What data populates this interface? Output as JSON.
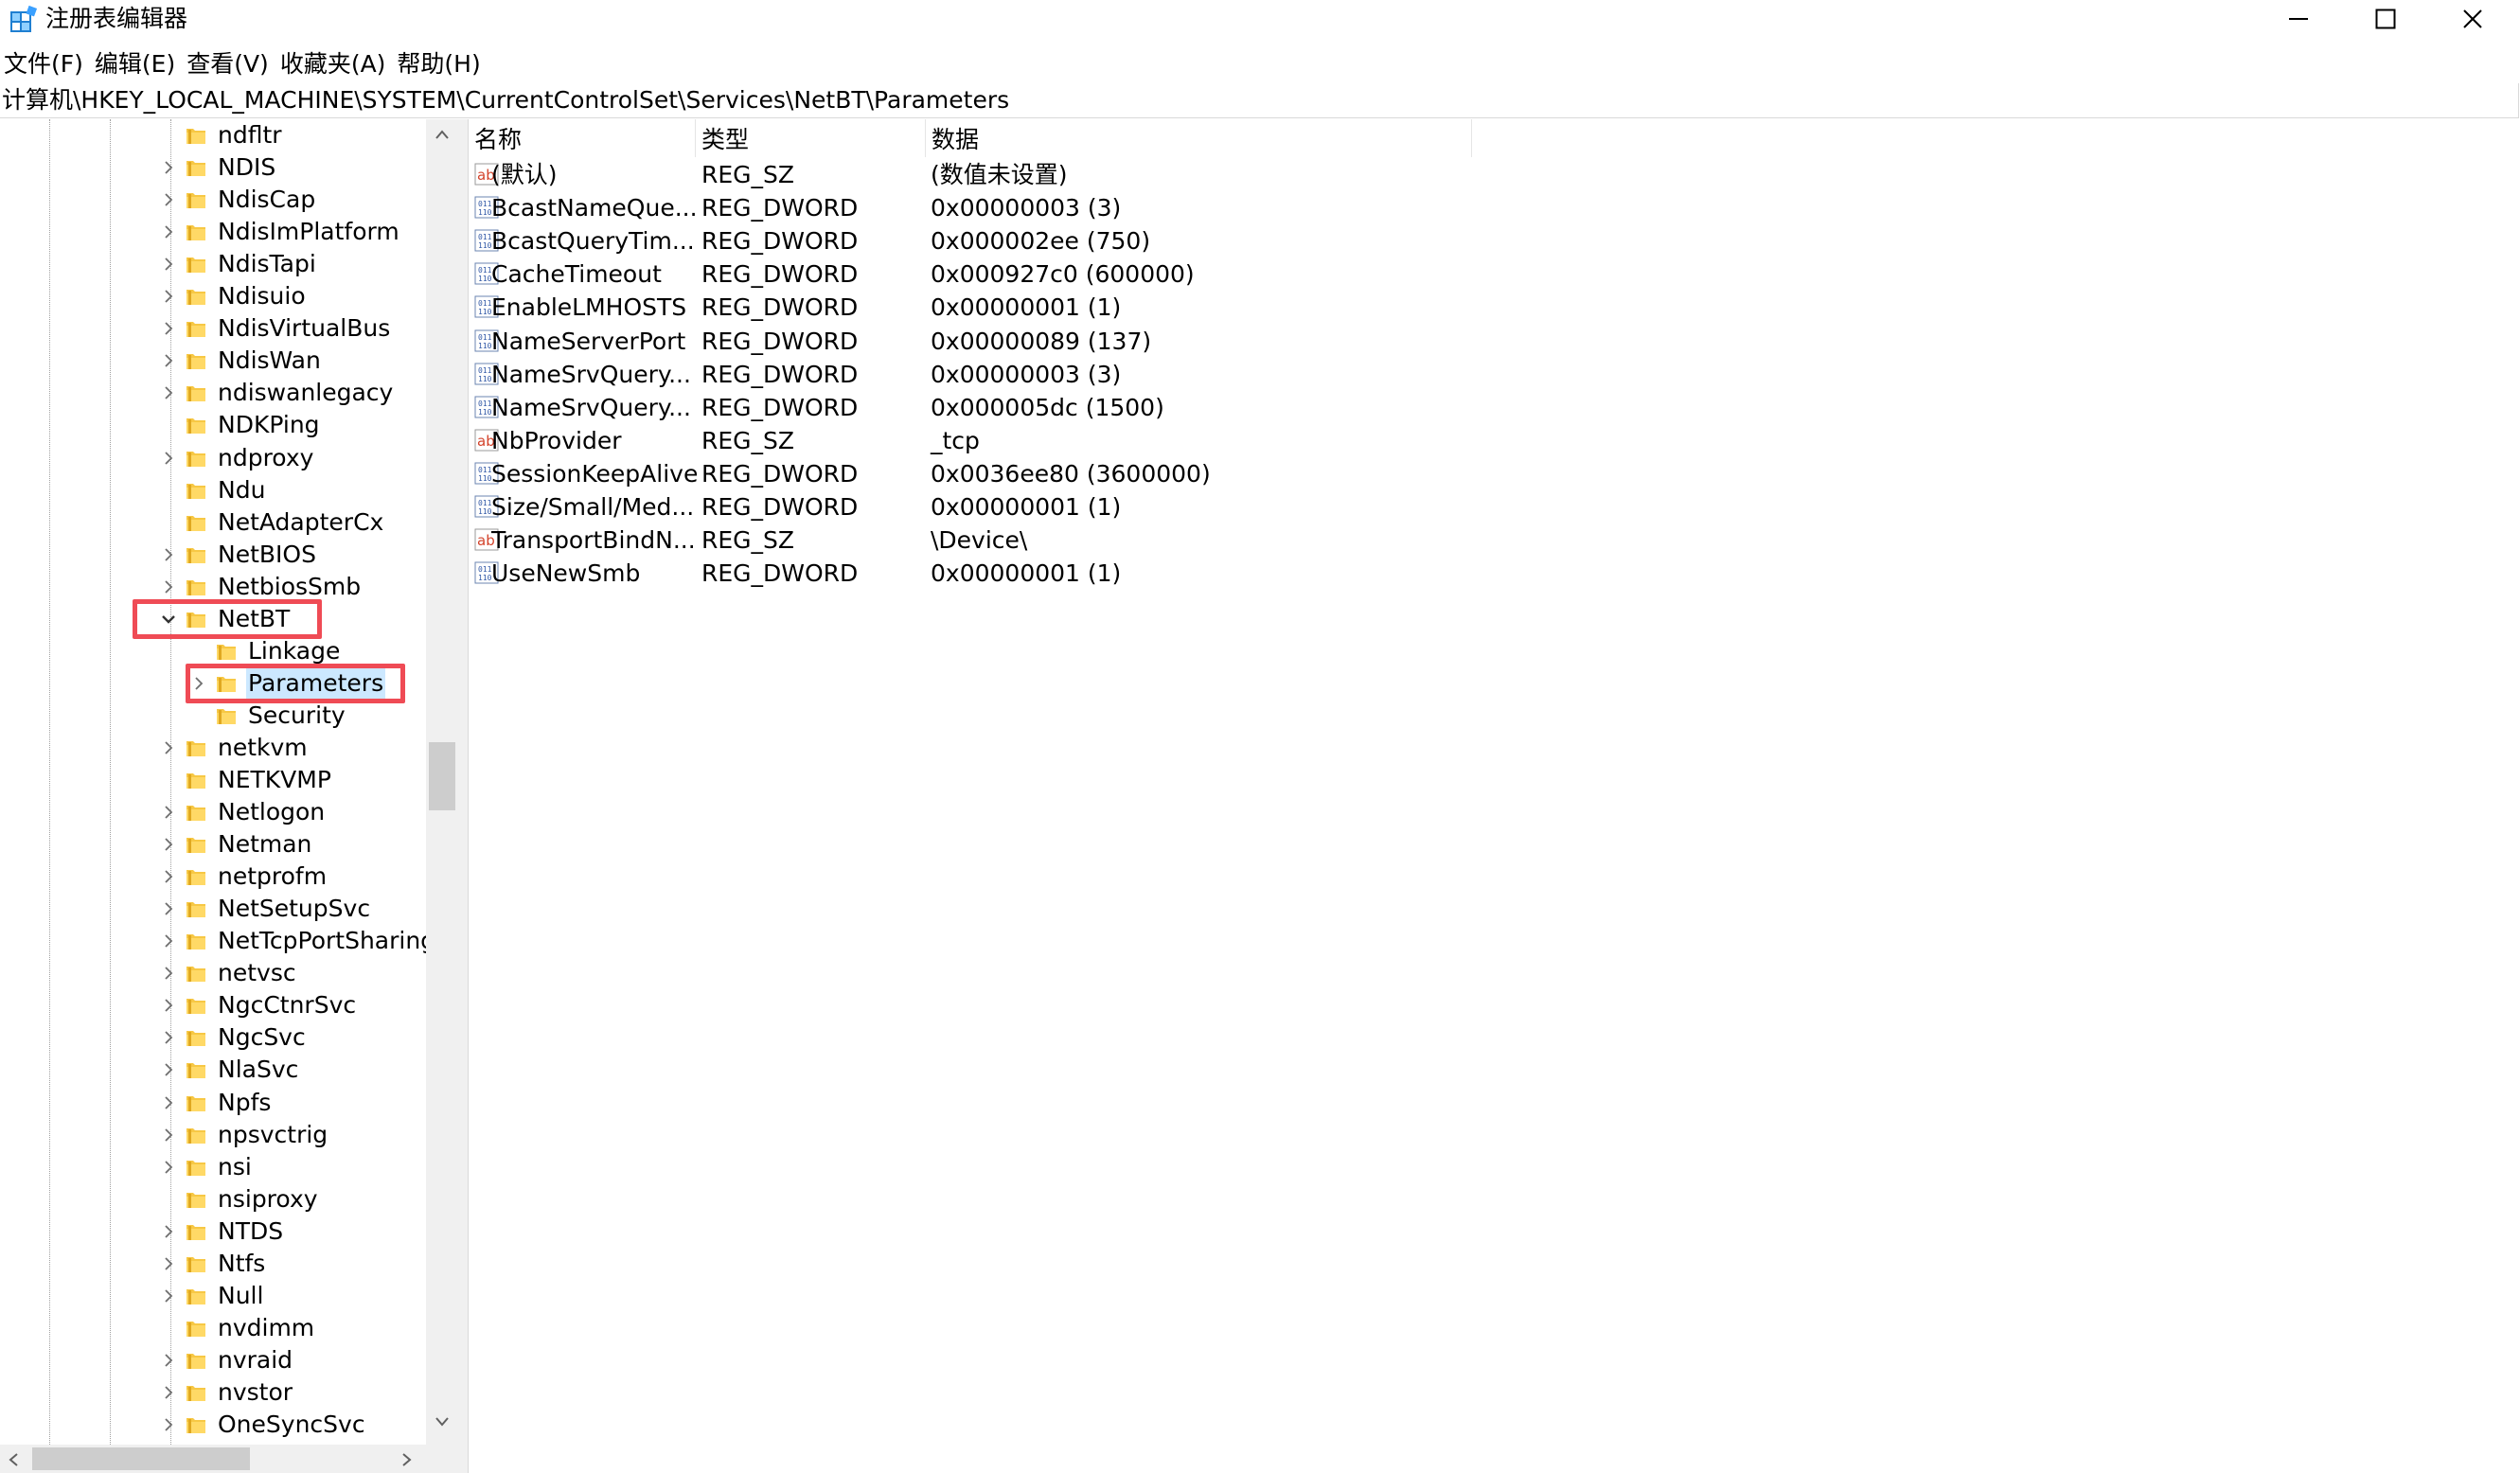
{
  "window": {
    "title": "注册表编辑器",
    "minimize_icon": "minimize-icon",
    "maximize_icon": "maximize-icon",
    "close_icon": "close-icon"
  },
  "menu": [
    "文件(F)",
    "编辑(E)",
    "查看(V)",
    "收藏夹(A)",
    "帮助(H)"
  ],
  "address": "计算机\\HKEY_LOCAL_MACHINE\\SYSTEM\\CurrentControlSet\\Services\\NetBT\\Parameters",
  "tree": [
    {
      "label": "ndfltr",
      "expander": "none"
    },
    {
      "label": "NDIS",
      "expander": "collapsed"
    },
    {
      "label": "NdisCap",
      "expander": "collapsed"
    },
    {
      "label": "NdisImPlatform",
      "expander": "collapsed"
    },
    {
      "label": "NdisTapi",
      "expander": "collapsed"
    },
    {
      "label": "Ndisuio",
      "expander": "collapsed"
    },
    {
      "label": "NdisVirtualBus",
      "expander": "collapsed"
    },
    {
      "label": "NdisWan",
      "expander": "collapsed"
    },
    {
      "label": "ndiswanlegacy",
      "expander": "collapsed"
    },
    {
      "label": "NDKPing",
      "expander": "none"
    },
    {
      "label": "ndproxy",
      "expander": "collapsed"
    },
    {
      "label": "Ndu",
      "expander": "none"
    },
    {
      "label": "NetAdapterCx",
      "expander": "none"
    },
    {
      "label": "NetBIOS",
      "expander": "collapsed"
    },
    {
      "label": "NetbiosSmb",
      "expander": "collapsed"
    },
    {
      "label": "NetBT",
      "expander": "expanded",
      "highlighted": true
    },
    {
      "label": "Linkage",
      "expander": "none",
      "child": true
    },
    {
      "label": "Parameters",
      "expander": "collapsed",
      "child": true,
      "selected": true,
      "highlighted": true
    },
    {
      "label": "Security",
      "expander": "none",
      "child": true
    },
    {
      "label": "netkvm",
      "expander": "collapsed"
    },
    {
      "label": "NETKVMP",
      "expander": "none"
    },
    {
      "label": "Netlogon",
      "expander": "collapsed"
    },
    {
      "label": "Netman",
      "expander": "collapsed"
    },
    {
      "label": "netprofm",
      "expander": "collapsed"
    },
    {
      "label": "NetSetupSvc",
      "expander": "collapsed"
    },
    {
      "label": "NetTcpPortSharing",
      "expander": "collapsed"
    },
    {
      "label": "netvsc",
      "expander": "collapsed"
    },
    {
      "label": "NgcCtnrSvc",
      "expander": "collapsed"
    },
    {
      "label": "NgcSvc",
      "expander": "collapsed"
    },
    {
      "label": "NlaSvc",
      "expander": "collapsed"
    },
    {
      "label": "Npfs",
      "expander": "collapsed"
    },
    {
      "label": "npsvctrig",
      "expander": "collapsed"
    },
    {
      "label": "nsi",
      "expander": "collapsed"
    },
    {
      "label": "nsiproxy",
      "expander": "none"
    },
    {
      "label": "NTDS",
      "expander": "collapsed"
    },
    {
      "label": "Ntfs",
      "expander": "collapsed"
    },
    {
      "label": "Null",
      "expander": "collapsed"
    },
    {
      "label": "nvdimm",
      "expander": "none"
    },
    {
      "label": "nvraid",
      "expander": "collapsed"
    },
    {
      "label": "nvstor",
      "expander": "collapsed"
    },
    {
      "label": "OneSyncSvc",
      "expander": "collapsed"
    }
  ],
  "columns": {
    "name": "名称",
    "type": "类型",
    "data": "数据"
  },
  "values": [
    {
      "name": "(默认)",
      "type": "REG_SZ",
      "data": "(数值未设置)",
      "icon": "string-value-icon"
    },
    {
      "name": "BcastNameQue...",
      "type": "REG_DWORD",
      "data": "0x00000003 (3)",
      "icon": "binary-value-icon"
    },
    {
      "name": "BcastQueryTim...",
      "type": "REG_DWORD",
      "data": "0x000002ee (750)",
      "icon": "binary-value-icon"
    },
    {
      "name": "CacheTimeout",
      "type": "REG_DWORD",
      "data": "0x000927c0 (600000)",
      "icon": "binary-value-icon"
    },
    {
      "name": "EnableLMHOSTS",
      "type": "REG_DWORD",
      "data": "0x00000001 (1)",
      "icon": "binary-value-icon"
    },
    {
      "name": "NameServerPort",
      "type": "REG_DWORD",
      "data": "0x00000089 (137)",
      "icon": "binary-value-icon"
    },
    {
      "name": "NameSrvQuery...",
      "type": "REG_DWORD",
      "data": "0x00000003 (3)",
      "icon": "binary-value-icon"
    },
    {
      "name": "NameSrvQuery...",
      "type": "REG_DWORD",
      "data": "0x000005dc (1500)",
      "icon": "binary-value-icon"
    },
    {
      "name": "NbProvider",
      "type": "REG_SZ",
      "data": "_tcp",
      "icon": "string-value-icon"
    },
    {
      "name": "SessionKeepAlive",
      "type": "REG_DWORD",
      "data": "0x0036ee80 (3600000)",
      "icon": "binary-value-icon"
    },
    {
      "name": "Size/Small/Med...",
      "type": "REG_DWORD",
      "data": "0x00000001 (1)",
      "icon": "binary-value-icon"
    },
    {
      "name": "TransportBindN...",
      "type": "REG_SZ",
      "data": "\\Device\\",
      "icon": "string-value-icon"
    },
    {
      "name": "UseNewSmb",
      "type": "REG_DWORD",
      "data": "0x00000001 (1)",
      "icon": "binary-value-icon"
    }
  ],
  "colors": {
    "highlight": "#ef4b55",
    "selection": "#cce8ff",
    "folder": "#f7c845"
  }
}
